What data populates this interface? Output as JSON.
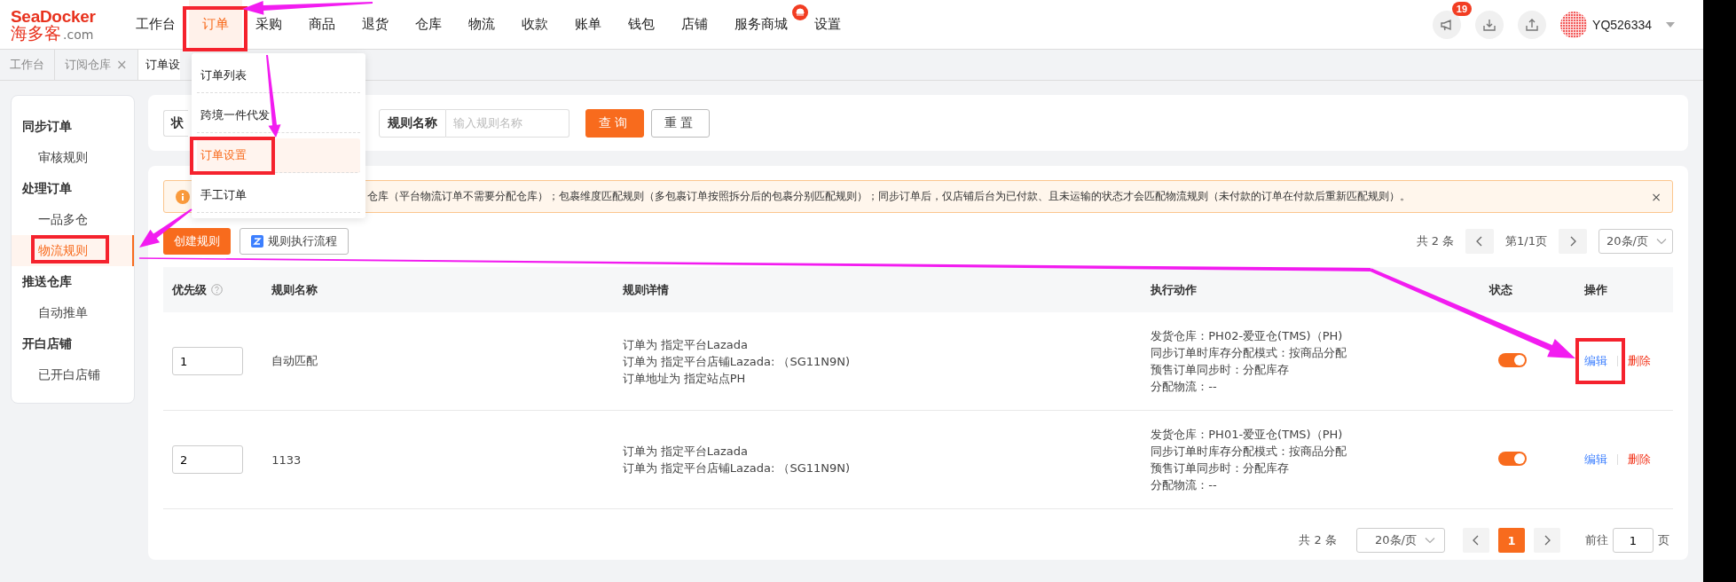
{
  "header": {
    "logo": {
      "brand": "SeaDocker",
      "name_cn": "海多客",
      "domain": ".com"
    },
    "nav": [
      {
        "label": "工作台",
        "selected": false,
        "badge": false
      },
      {
        "label": "订单",
        "selected": true,
        "badge": false
      },
      {
        "label": "采购",
        "selected": false,
        "badge": false
      },
      {
        "label": "商品",
        "selected": false,
        "badge": false
      },
      {
        "label": "退货",
        "selected": false,
        "badge": false
      },
      {
        "label": "仓库",
        "selected": false,
        "badge": false
      },
      {
        "label": "物流",
        "selected": false,
        "badge": false
      },
      {
        "label": "收款",
        "selected": false,
        "badge": false
      },
      {
        "label": "账单",
        "selected": false,
        "badge": false
      },
      {
        "label": "钱包",
        "selected": false,
        "badge": false
      },
      {
        "label": "店铺",
        "selected": false,
        "badge": false
      },
      {
        "label": "服务商城",
        "selected": false,
        "badge": true
      },
      {
        "label": "设置",
        "selected": false,
        "badge": false
      }
    ],
    "notification_count": "19",
    "user": "YQ526334"
  },
  "tabs": [
    {
      "label": "工作台",
      "selected": false
    },
    {
      "label": "订阅仓库",
      "selected": false,
      "close": "×"
    },
    {
      "label": "订单设",
      "selected": true
    }
  ],
  "dropdown": {
    "items": [
      {
        "label": "订单列表",
        "selected": false
      },
      {
        "label": "跨境一件代发",
        "selected": false
      },
      {
        "label": "订单设置",
        "selected": true
      },
      {
        "label": "手工订单",
        "selected": false
      }
    ]
  },
  "sidebar": {
    "groups": [
      {
        "title": "同步订单",
        "items": [
          {
            "label": "审核规则",
            "selected": false
          }
        ]
      },
      {
        "title": "处理订单",
        "items": [
          {
            "label": "一品多仓",
            "selected": false
          },
          {
            "label": "物流规则",
            "selected": true
          }
        ]
      },
      {
        "title": "推送仓库",
        "items": [
          {
            "label": "自动推单",
            "selected": false
          }
        ]
      },
      {
        "title": "开白店铺",
        "items": [
          {
            "label": "已开白店铺",
            "selected": false
          }
        ]
      }
    ]
  },
  "filters": {
    "status_label": "状",
    "name_label": "规则名称",
    "name_placeholder": "输入规则名称",
    "search": "查询",
    "reset": "重置"
  },
  "alert": {
    "text": "仓库（平台物流订单不需要分配仓库）；包裹维度匹配规则（多包裹订单按照拆分后的包裹分别匹配规则）；同步订单后，仅店铺后台为已付款、且未运输的状态才会匹配物流规则（未付款的订单在付款后重新匹配规则）。",
    "close": "×"
  },
  "toolbar": {
    "create": "创建规则",
    "flow": "规则执行流程"
  },
  "top_pager": {
    "total": "共 2 条",
    "page": "第1/1页",
    "page_size": "20条/页"
  },
  "table": {
    "columns": [
      {
        "label": "优先级",
        "help": true
      },
      {
        "label": "规则名称",
        "help": false
      },
      {
        "label": "规则详情",
        "help": false
      },
      {
        "label": "执行动作",
        "help": false
      },
      {
        "label": "状态",
        "help": false
      },
      {
        "label": "操作",
        "help": false
      }
    ],
    "rows": [
      {
        "priority": "1",
        "name": "自动匹配",
        "details": [
          "订单为 指定平台Lazada",
          "订单为 指定平台店铺Lazada: （SG11N9N)",
          "订单地址为 指定站点PH"
        ],
        "actions": [
          "发货仓库：PH02-爱亚仓(TMS)（PH)",
          "同步订单时库存分配模式：按商品分配",
          "预售订单同步时：分配库存",
          "分配物流：--"
        ],
        "enabled": true,
        "edit": "编辑",
        "delete": "删除"
      },
      {
        "priority": "2",
        "name": "1133",
        "details": [
          "订单为 指定平台Lazada",
          "订单为 指定平台店铺Lazada: （SG11N9N)"
        ],
        "actions": [
          "发货仓库：PH01-爱亚仓(TMS)（PH)",
          "同步订单时库存分配模式：按商品分配",
          "预售订单同步时：分配库存",
          "分配物流：--"
        ],
        "enabled": true,
        "edit": "编辑",
        "delete": "删除"
      }
    ]
  },
  "pager": {
    "total": "共 2 条",
    "page_size": "20条/页",
    "pages": [
      {
        "label": "1",
        "selected": true
      }
    ],
    "goto": "前往",
    "goto_value": "1",
    "suffix": "页"
  }
}
